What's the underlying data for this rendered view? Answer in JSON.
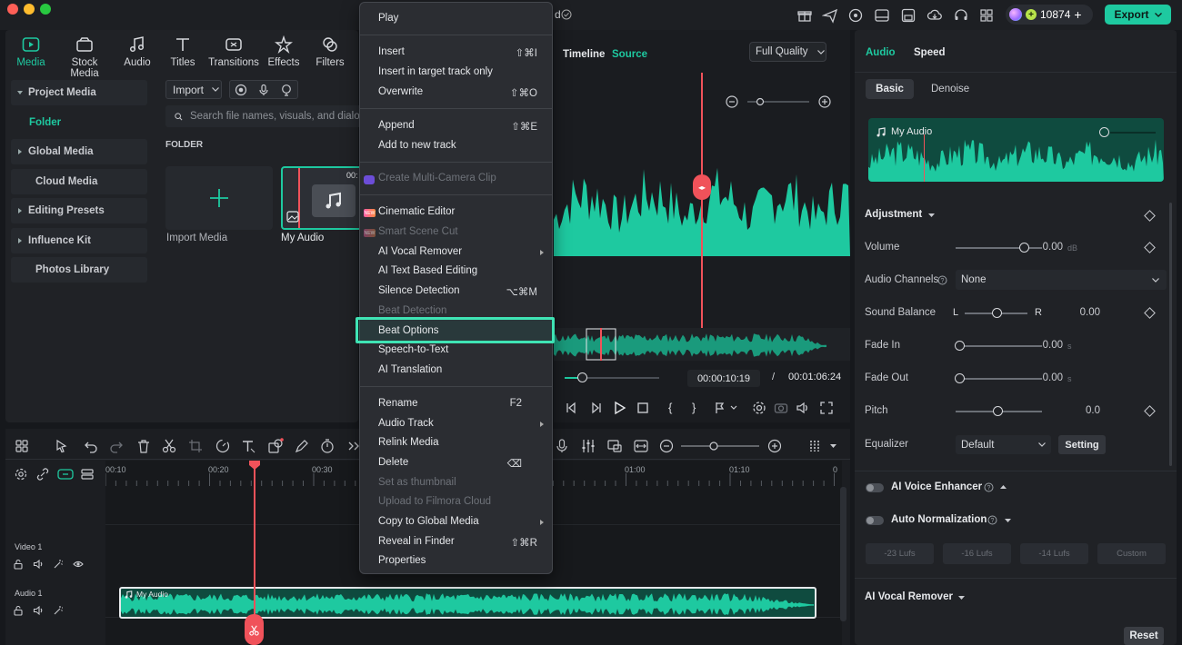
{
  "titlebar": {
    "credits": "10874",
    "export_label": "Export"
  },
  "media_tabs": [
    "Media",
    "Stock Media",
    "Audio",
    "Titles",
    "Transitions",
    "Effects",
    "Filters"
  ],
  "media_sidebar": {
    "project_media": "Project Media",
    "folder": "Folder",
    "global_media": "Global Media",
    "cloud_media": "Cloud Media",
    "editing_presets": "Editing Presets",
    "influence_kit": "Influence Kit",
    "photos_library": "Photos Library"
  },
  "library": {
    "import_label": "Import",
    "search_placeholder": "Search file names, visuals, and dialog",
    "folder_heading": "FOLDER",
    "import_media_label": "Import Media",
    "audio_item_label": "My Audio",
    "audio_item_duration": "00:"
  },
  "player": {
    "tab_timeline": "Timeline",
    "tab_source": "Source",
    "quality": "Full Quality",
    "current_time": "00:00:10:19",
    "separator": "/",
    "total_time": "00:01:06:24"
  },
  "context_menu": {
    "play": "Play",
    "insert": "Insert",
    "insert_sc": "⇧⌘I",
    "insert_target": "Insert in target track only",
    "overwrite": "Overwrite",
    "overwrite_sc": "⇧⌘O",
    "append": "Append",
    "append_sc": "⇧⌘E",
    "add_new_track": "Add to new track",
    "multicam": "Create Multi-Camera Clip",
    "cinematic": "Cinematic Editor",
    "smart_scene": "Smart Scene Cut",
    "vocal_remover": "AI Vocal Remover",
    "text_editing": "AI Text Based Editing",
    "silence": "Silence Detection",
    "silence_sc": "⌥⌘M",
    "beat_detection": "Beat Detection",
    "beat_options": "Beat Options",
    "speech_to_text": "Speech-to-Text",
    "translation": "AI Translation",
    "rename": "Rename",
    "rename_sc": "F2",
    "audio_track": "Audio Track",
    "relink": "Relink Media",
    "delete": "Delete",
    "delete_sc": "⌫",
    "thumbnail": "Set as thumbnail",
    "upload": "Upload to Filmora Cloud",
    "copy_global": "Copy to Global Media",
    "reveal": "Reveal in Finder",
    "reveal_sc": "⇧⌘R",
    "properties": "Properties",
    "new_badge": "NEW"
  },
  "inspector": {
    "tab_audio": "Audio",
    "tab_speed": "Speed",
    "sub_basic": "Basic",
    "sub_denoise": "Denoise",
    "clip_name": "My Audio",
    "adjustment": "Adjustment",
    "volume_label": "Volume",
    "volume_value": "0.00",
    "volume_unit": "dB",
    "channels_label": "Audio Channels",
    "channels_value": "None",
    "balance_label": "Sound Balance",
    "balance_l": "L",
    "balance_r": "R",
    "balance_value": "0.00",
    "fadein_label": "Fade In",
    "fadein_value": "0.00",
    "fadein_unit": "s",
    "fadeout_label": "Fade Out",
    "fadeout_value": "0.00",
    "fadeout_unit": "s",
    "pitch_label": "Pitch",
    "pitch_value": "0.0",
    "eq_label": "Equalizer",
    "eq_value": "Default",
    "eq_setting": "Setting",
    "voice_enhancer": "AI Voice Enhancer",
    "auto_norm": "Auto Normalization",
    "lufs": [
      "-23 Lufs",
      "-16 Lufs",
      "-14 Lufs",
      "Custom"
    ],
    "vocal_remover": "AI Vocal Remover",
    "reset": "Reset"
  },
  "timeline": {
    "ruler": [
      "00:10",
      "00:20",
      "00:30",
      "01:00",
      "01:10",
      "0"
    ],
    "video_track": "Video 1",
    "audio_track": "Audio 1",
    "clip_name": "My Audio"
  },
  "colors": {
    "accent": "#1ec9a0",
    "playhead": "#f0525a",
    "highlight": "#3fe3b4"
  }
}
